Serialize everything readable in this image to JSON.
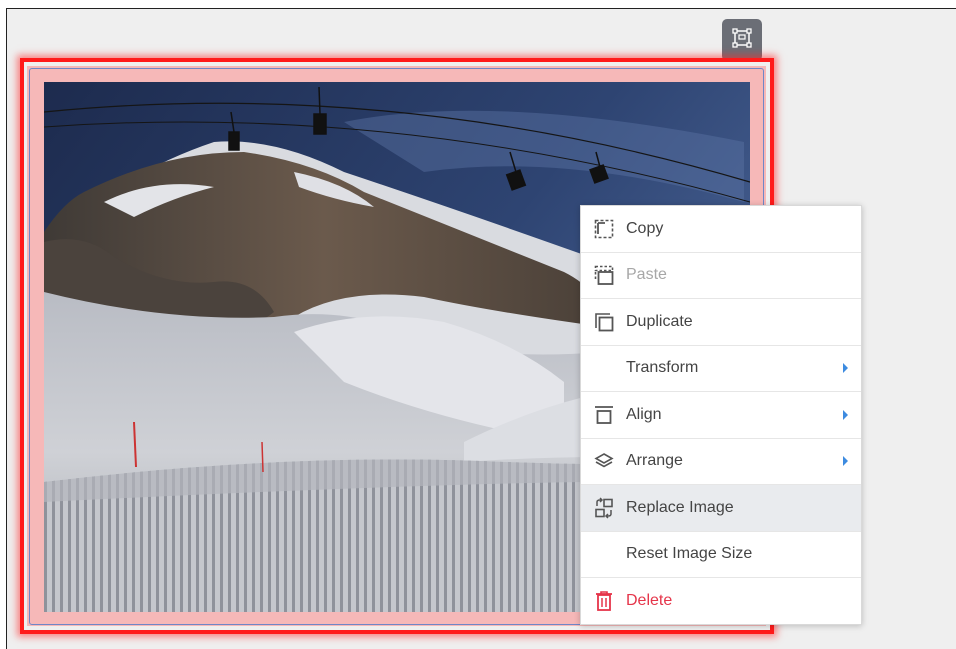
{
  "toolbar": {
    "transform_icon": "crop-transform-icon"
  },
  "image": {
    "subject": "",
    "selected": true
  },
  "context_menu": {
    "items": [
      {
        "label": "Copy",
        "icon": "copy-icon",
        "state": "enabled"
      },
      {
        "label": "Paste",
        "icon": "paste-icon",
        "state": "disabled"
      },
      {
        "label": "Duplicate",
        "icon": "duplicate-icon",
        "state": "enabled"
      },
      {
        "label": "Transform",
        "icon": "",
        "state": "submenu"
      },
      {
        "label": "Align",
        "icon": "align-icon",
        "state": "submenu"
      },
      {
        "label": "Arrange",
        "icon": "layers-icon",
        "state": "submenu"
      },
      {
        "label": "Replace Image",
        "icon": "replace-image-icon",
        "state": "hovered"
      },
      {
        "label": "Reset Image Size",
        "icon": "",
        "state": "enabled"
      },
      {
        "label": "Delete",
        "icon": "trash-icon",
        "state": "danger"
      }
    ]
  },
  "colors": {
    "selection_border": "#ff1a1a",
    "selection_fill": "#f6b8b8",
    "delete_red": "#e5354a",
    "submenu_arrow": "#3d8be0",
    "hover_bg": "#e9ebee"
  }
}
